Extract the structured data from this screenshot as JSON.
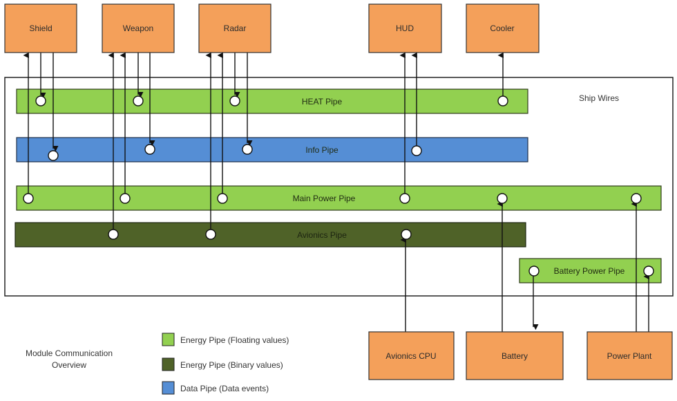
{
  "title": "Module Communication Overview",
  "container": {
    "label": "Ship Wires"
  },
  "colors": {
    "module": "#f4a05a",
    "energy_float": "#92d050",
    "energy_binary": "#4f6228",
    "data": "#558ed5",
    "line": "#111111"
  },
  "modules": {
    "shield": "Shield",
    "weapon": "Weapon",
    "radar": "Radar",
    "hud": "HUD",
    "cooler": "Cooler",
    "avionics_cpu": "Avionics CPU",
    "battery": "Battery",
    "power_plant": "Power Plant"
  },
  "pipes": {
    "heat": "HEAT Pipe",
    "info": "Info Pipe",
    "main_power": "Main Power Pipe",
    "avionics": "Avionics Pipe",
    "battery_power": "Battery Power Pipe"
  },
  "connections": [
    {
      "module": "Shield",
      "pipe": "Main Power Pipe",
      "direction": "to-module"
    },
    {
      "module": "Shield",
      "pipe": "HEAT Pipe",
      "direction": "to-pipe"
    },
    {
      "module": "Shield",
      "pipe": "Info Pipe",
      "direction": "to-pipe"
    },
    {
      "module": "Weapon",
      "pipe": "Avionics Pipe",
      "direction": "to-module"
    },
    {
      "module": "Weapon",
      "pipe": "Main Power Pipe",
      "direction": "to-module"
    },
    {
      "module": "Weapon",
      "pipe": "HEAT Pipe",
      "direction": "to-pipe"
    },
    {
      "module": "Weapon",
      "pipe": "Info Pipe",
      "direction": "to-pipe"
    },
    {
      "module": "Radar",
      "pipe": "Avionics Pipe",
      "direction": "to-module"
    },
    {
      "module": "Radar",
      "pipe": "Main Power Pipe",
      "direction": "to-module"
    },
    {
      "module": "Radar",
      "pipe": "HEAT Pipe",
      "direction": "to-pipe"
    },
    {
      "module": "Radar",
      "pipe": "Info Pipe",
      "direction": "to-pipe"
    },
    {
      "module": "HUD",
      "pipe": "Main Power Pipe",
      "direction": "to-module"
    },
    {
      "module": "HUD",
      "pipe": "Info Pipe",
      "direction": "to-module"
    },
    {
      "module": "Cooler",
      "pipe": "HEAT Pipe",
      "direction": "to-module"
    },
    {
      "module": "Avionics CPU",
      "pipe": "Avionics Pipe",
      "direction": "to-pipe"
    },
    {
      "module": "Battery",
      "pipe": "Main Power Pipe",
      "direction": "to-pipe"
    },
    {
      "module": "Battery",
      "pipe": "Battery Power Pipe",
      "direction": "to-module"
    },
    {
      "module": "Power Plant",
      "pipe": "Main Power Pipe",
      "direction": "to-pipe"
    },
    {
      "module": "Power Plant",
      "pipe": "Battery Power Pipe",
      "direction": "to-pipe"
    }
  ],
  "legend": {
    "items": [
      {
        "label": "Energy Pipe (Floating values)",
        "color": "#92d050"
      },
      {
        "label": "Energy Pipe (Binary values)",
        "color": "#4f6228"
      },
      {
        "label": "Data Pipe (Data events)",
        "color": "#558ed5"
      }
    ]
  },
  "overview_label": [
    "Module Communication",
    "Overview"
  ]
}
